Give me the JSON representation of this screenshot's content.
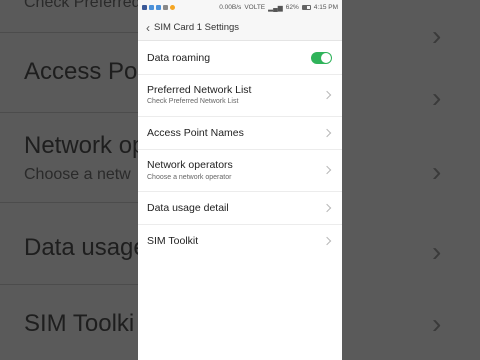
{
  "status_bar": {
    "speed": "0.00B/s",
    "network": "VOLTE",
    "battery": "62%",
    "time": "4:15 PM",
    "icon_colors": [
      "#3b5998",
      "#4a90d9",
      "#4a90d9",
      "#888888",
      "#f5a623"
    ]
  },
  "header": {
    "back_icon": "chevron-left-icon",
    "title": "SIM Card 1 Settings"
  },
  "settings": {
    "data_roaming": {
      "label": "Data roaming",
      "enabled": true,
      "accent": "#2fb35a"
    },
    "preferred_network": {
      "label": "Preferred Network List",
      "subtitle": "Check Preferred Network List"
    },
    "apn": {
      "label": "Access Point Names"
    },
    "network_operators": {
      "label": "Network operators",
      "subtitle": "Choose a network operator"
    },
    "data_usage": {
      "label": "Data usage detail"
    },
    "sim_toolkit": {
      "label": "SIM Toolkit"
    }
  },
  "background": {
    "top_sub": "Check Preferred",
    "access": "Access Po",
    "network": "Network op",
    "network_sub": "Choose a netw",
    "data_usage": "Data usage",
    "sim_toolkit": "SIM Toolki"
  }
}
